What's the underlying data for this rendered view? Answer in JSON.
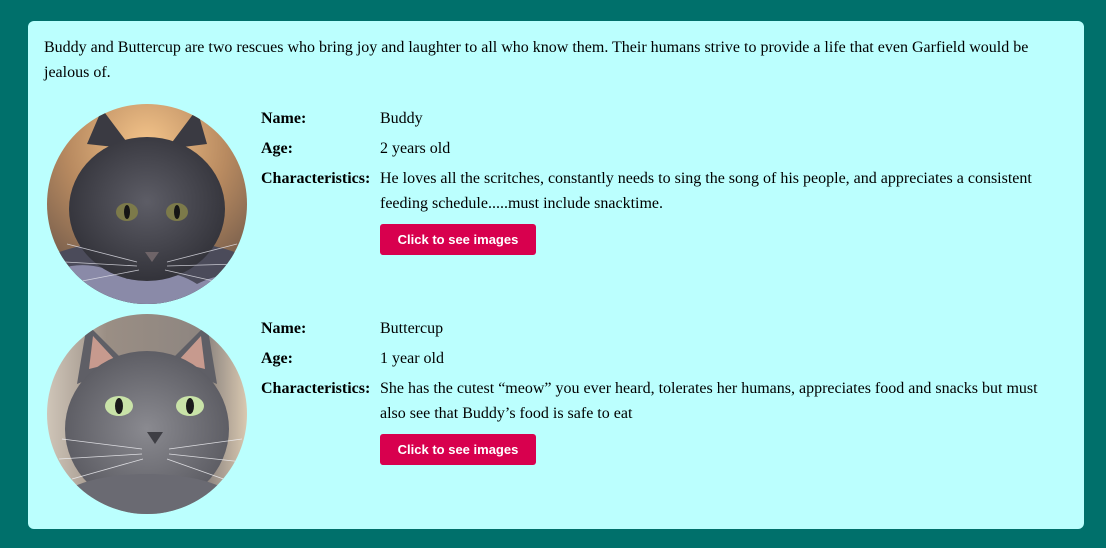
{
  "intro": "Buddy and Buttercup are two rescues who bring joy and laughter to all who know them. Their humans strive to provide a life that even Garfield would be jealous of.",
  "labels": {
    "name": "Name:",
    "age": "Age:",
    "characteristics": "Characteristics:"
  },
  "pets": [
    {
      "name": "Buddy",
      "age": "2 years old",
      "characteristics": "He loves all the scritches, constantly needs to sing the song of his people, and appreciates a consistent feeding schedule.....must include snacktime.",
      "button_label": "Click to see images",
      "photo_icon": "gray-cat-photo"
    },
    {
      "name": "Buttercup",
      "age": "1 year old",
      "characteristics": "She has the cutest “meow” you ever heard, tolerates her humans, appreciates food and snacks but must also see that Buddy’s food is safe to eat",
      "button_label": "Click to see images",
      "photo_icon": "gray-cat-photo"
    }
  ],
  "colors": {
    "page_background": "#00706b",
    "card_background": "#bbfffe",
    "button": "#d8004e",
    "button_text": "#ffffff"
  }
}
